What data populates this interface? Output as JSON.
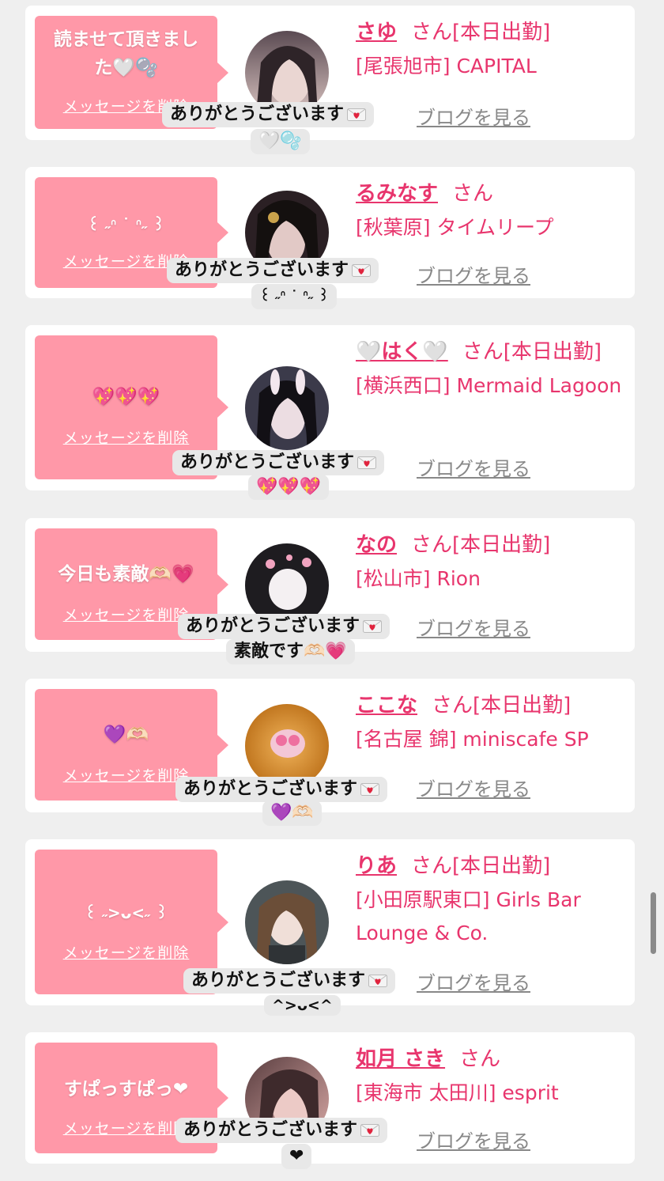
{
  "common": {
    "delete_label": "メッセージを削除",
    "blog_label": "ブログを見る",
    "san": "さん",
    "thanks": "ありがとうございます"
  },
  "cards": [
    {
      "bubble": "読ませて頂きまし\nた🤍🫧",
      "name": "さゆ",
      "status": "[本日出勤]",
      "area": "[尾張旭市]",
      "shop": "CAPITAL",
      "reply": "🤍🫧",
      "avatar_colors": [
        "#5a4a52",
        "#d9c3c0"
      ]
    },
    {
      "bubble": "꒰ ˶ᐢ ˙ ᐢ˶ ꒱",
      "name": "るみなす",
      "status": "",
      "area": "[秋葉原]",
      "shop": "タイムリープ",
      "reply": "꒰ ˶ᐢ ˙ ᐢ˶ ꒱",
      "avatar_colors": [
        "#2b2024",
        "#c9a7a4"
      ]
    },
    {
      "bubble": "💖💖💖",
      "name": "🤍はく🤍",
      "status": "[本日出勤]",
      "area": "[横浜西口]",
      "shop": "Mermaid Lagoon",
      "reply": "💖💖💖",
      "avatar_colors": [
        "#3b3a4a",
        "#e4d6df"
      ]
    },
    {
      "bubble": "今日も素敵🫶🏻💗",
      "name": "なの",
      "status": "[本日出勤]",
      "area": "[松山市]",
      "shop": "Rion",
      "reply": "素敵です🫶🏻💗",
      "avatar_colors": [
        "#1e1c20",
        "#f1d4dc"
      ]
    },
    {
      "bubble": "💜🫶🏻",
      "name": "ここな",
      "status": "[本日出勤]",
      "area": "[名古屋 錦]",
      "shop": "miniscafe SP",
      "reply": "💜🫶🏻",
      "avatar_colors": [
        "#d48a22",
        "#f0b35a"
      ]
    },
    {
      "bubble": "꒰ ˶>ᴗ<˶ ꒱",
      "name": "りあ",
      "status": "[本日出勤]",
      "area": "[小田原駅東口]",
      "shop": "Girls Bar Lounge & Co.",
      "reply": "^>ᴗ<^",
      "avatar_colors": [
        "#4d5558",
        "#cdd5d2"
      ]
    },
    {
      "bubble": "すぱっすぱっ❤",
      "name": "如月 さき",
      "status": "",
      "area": "[東海市 太田川]",
      "shop": "esprit",
      "reply": "❤",
      "avatar_colors": [
        "#5a3e40",
        "#d6a7a4"
      ]
    }
  ]
}
